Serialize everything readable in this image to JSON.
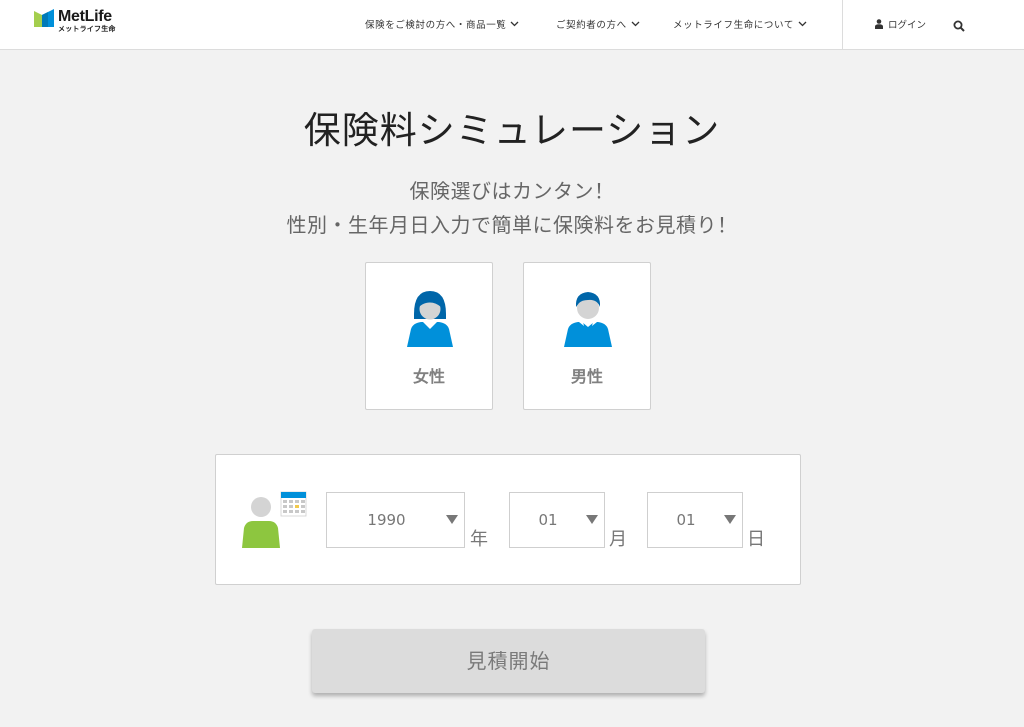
{
  "header": {
    "brand": "MetLife",
    "brand_sub": "メットライフ生命",
    "nav": [
      {
        "label": "保険をご検討の方へ・商品一覧"
      },
      {
        "label": "ご契約者の方へ"
      },
      {
        "label": "メットライフ生命について"
      }
    ],
    "login_label": "ログイン"
  },
  "main": {
    "title": "保険料シミュレーション",
    "subtitle_line1": "保険選びはカンタン！",
    "subtitle_line2": "性別・生年月日入力で簡単に保険料をお見積り！",
    "gender_options": [
      {
        "label": "女性"
      },
      {
        "label": "男性"
      }
    ],
    "birthdate": {
      "year": {
        "value": "1990",
        "unit": "年"
      },
      "month": {
        "value": "01",
        "unit": "月"
      },
      "day": {
        "value": "01",
        "unit": "日"
      }
    },
    "start_button": "見積開始"
  },
  "colors": {
    "brand_blue": "#0090da",
    "brand_green": "#a4ce4e",
    "person_green": "#8dc63f",
    "background": "#f2f2f2",
    "button_gray": "#dcdcdc"
  },
  "icons": {
    "logo": "metlife-logo-icon",
    "nav_chevron": "chevron-down-icon",
    "login": "person-icon",
    "search": "search-icon",
    "female": "female-avatar-icon",
    "male": "male-avatar-icon",
    "birthday": "person-calendar-icon",
    "select_caret": "caret-down-icon"
  }
}
